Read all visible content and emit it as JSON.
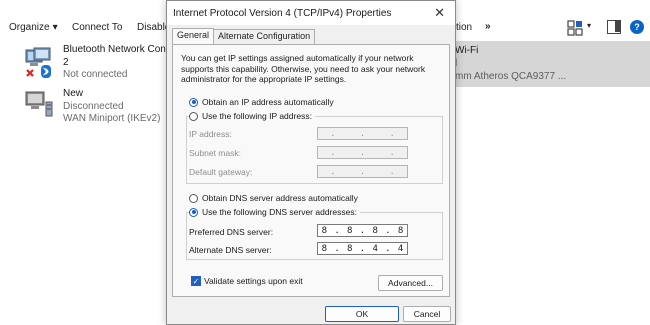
{
  "toolbar": {
    "organize": "Organize",
    "organize_caret": "▾",
    "connect_to": "Connect To",
    "disable": "Disable",
    "action_partial": "ction",
    "more": "»",
    "view_caret": "▾",
    "help": "?"
  },
  "adapters": {
    "bluetooth": {
      "name_line1": "Bluetooth Network Connec",
      "name_line2": "2",
      "status": "Not connected"
    },
    "new": {
      "name": "New",
      "status": "Disconnected",
      "device": "WAN Miniport (IKEv2)"
    },
    "wifi": {
      "name": "Wi-Fi",
      "line2": "l",
      "device": "mm Atheros QCA9377 ..."
    }
  },
  "dialog": {
    "title": "Internet Protocol Version 4 (TCP/IPv4) Properties",
    "close": "✕",
    "tabs": [
      "General",
      "Alternate Configuration"
    ],
    "intro": "You can get IP settings assigned automatically if your network supports this capability. Otherwise, you need to ask your network administrator for the appropriate IP settings.",
    "ip_auto": "Obtain an IP address automatically",
    "ip_manual": "Use the following IP address:",
    "ip_fields": {
      "ip_address": "IP address:",
      "subnet_mask": "Subnet mask:",
      "default_gateway": "Default gateway:"
    },
    "dns_auto": "Obtain DNS server address automatically",
    "dns_manual": "Use the following DNS server addresses:",
    "preferred_dns_label": "Preferred DNS server:",
    "preferred_dns": [
      "8",
      "8",
      "8",
      "8"
    ],
    "alternate_dns_label": "Alternate DNS server:",
    "alternate_dns": [
      "8",
      "8",
      "4",
      "4"
    ],
    "validate_label": "Validate settings upon exit",
    "advanced_button": "Advanced...",
    "ok_button": "OK",
    "cancel_button": "Cancel",
    "empty_ip_dots": [
      ".",
      ".",
      "."
    ],
    "ip_sep": "."
  },
  "colors": {
    "accent": "#1e5fbf",
    "selection": "#d6d6d6",
    "dialog_bg": "#f0f0f0"
  }
}
